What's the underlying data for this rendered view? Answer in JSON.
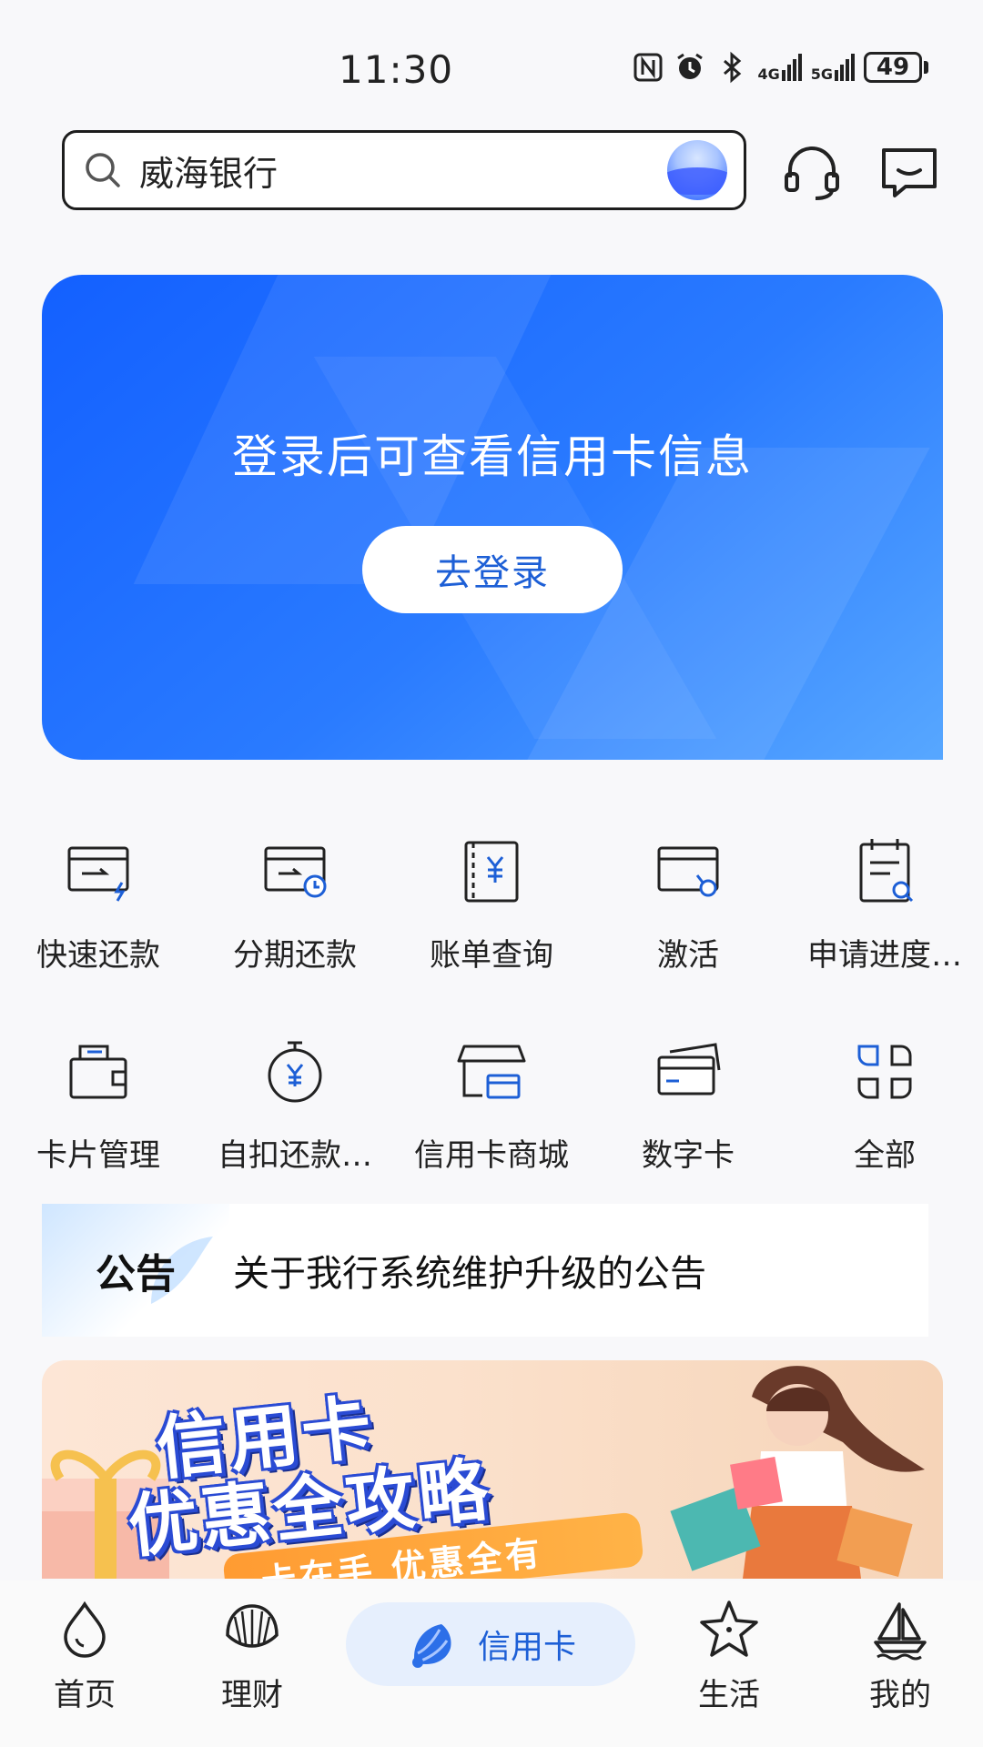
{
  "status_bar": {
    "time": "11:30",
    "signal_1": "4G",
    "signal_2": "5G",
    "battery": "49"
  },
  "header": {
    "search_text": "威海银行"
  },
  "login_banner": {
    "title": "登录后可查看信用卡信息",
    "button": "去登录"
  },
  "quick_grid": {
    "row1": [
      "快速还款",
      "分期还款",
      "账单查询",
      "激活",
      "申请进度…"
    ],
    "row2": [
      "卡片管理",
      "自扣还款…",
      "信用卡商城",
      "数字卡",
      "全部"
    ]
  },
  "notice": {
    "tag": "公告",
    "text": "关于我行系统维护升级的公告"
  },
  "promo": {
    "title_line1": "信用卡",
    "title_line2": "优惠全攻略",
    "subtitle": "卡在手 优惠全有"
  },
  "tab_bar": {
    "home": "首页",
    "wealth": "理财",
    "credit": "信用卡",
    "life": "生活",
    "mine": "我的"
  },
  "colors": {
    "accent": "#1d5fd6",
    "banner_start": "#1360ff",
    "banner_end": "#57a7ff",
    "active_tab_bg": "#e6effd"
  }
}
